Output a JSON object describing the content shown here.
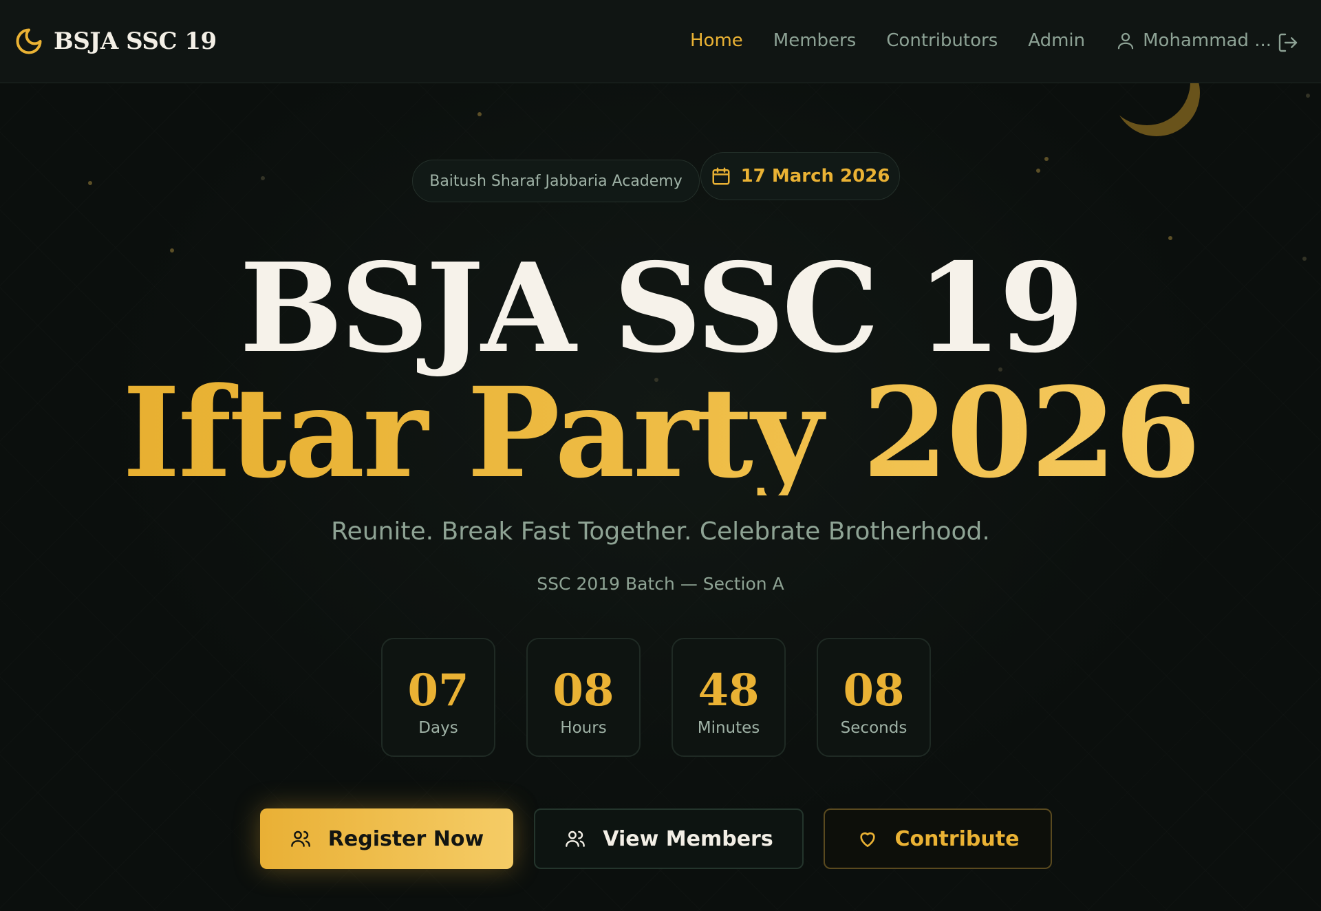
{
  "brand": {
    "name": "BSJA SSC 19",
    "icon": "moon-icon"
  },
  "nav": {
    "items": [
      {
        "label": "Home",
        "active": true
      },
      {
        "label": "Members",
        "active": false
      },
      {
        "label": "Contributors",
        "active": false
      },
      {
        "label": "Admin",
        "active": false
      }
    ],
    "user_name": "Mohammad ...",
    "user_icon": "user-icon",
    "logout_icon": "logout-icon"
  },
  "hero": {
    "academy": "Baitush Sharaf Jabbaria Academy",
    "date": "17 March 2026",
    "date_icon": "calendar-icon",
    "title_line1": "BSJA SSC 19",
    "title_line2": "Iftar Party 2026",
    "tagline": "Reunite. Break Fast Together. Celebrate Brotherhood.",
    "batch": "SSC 2019 Batch — Section A"
  },
  "countdown": [
    {
      "value": "07",
      "label": "Days"
    },
    {
      "value": "08",
      "label": "Hours"
    },
    {
      "value": "48",
      "label": "Minutes"
    },
    {
      "value": "08",
      "label": "Seconds"
    }
  ],
  "actions": {
    "register": "Register Now",
    "view_members": "View Members",
    "contribute": "Contribute"
  },
  "colors": {
    "accent": "#eab234",
    "background": "#0b0f0d",
    "text_muted": "#8da295"
  }
}
